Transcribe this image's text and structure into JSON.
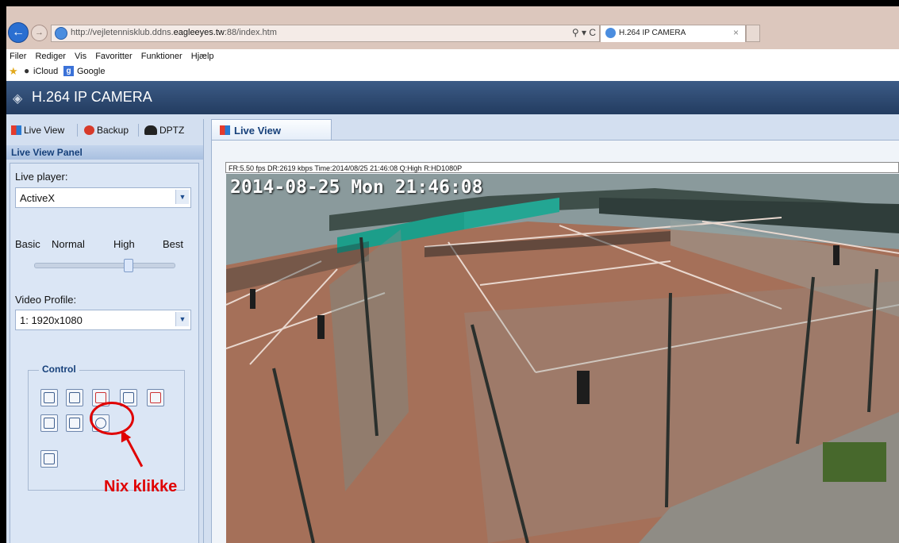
{
  "browser": {
    "url_prefix": "http://vejletennisklub.ddns.",
    "url_domain": "eagleeyes.tw",
    "url_suffix": ":88/index.htm",
    "search_glyph": "⚲ ▾ C",
    "tab_title": "H.264 IP CAMERA",
    "tab_close": "×",
    "menu": [
      "Filer",
      "Rediger",
      "Vis",
      "Favoritter",
      "Funktioner",
      "Hjælp"
    ],
    "favorites": [
      "iCloud",
      "Google"
    ]
  },
  "app": {
    "title": "H.264 IP CAMERA",
    "nav": [
      "Live View",
      "Backup",
      "DPTZ"
    ],
    "panel_title": "Live View Panel",
    "live_player_label": "Live player:",
    "live_player_value": "ActiveX",
    "quality_labels": [
      "Basic",
      "Normal",
      "High",
      "Best"
    ],
    "quality_value": "High",
    "video_profile_label": "Video Profile:",
    "video_profile_value": "1: 1920x1080",
    "control_label": "Control",
    "live_tab": "Live View",
    "status_line": "FR:5.50 fps  DR:2619 kbps Time:2014/08/25 21:46:08 Q:High R:HD1080P",
    "osd_timestamp": "2014-08-25 Mon 21:46:08",
    "annotation": "Nix klikke"
  },
  "colors": {
    "header": "#2c4a73",
    "panel": "#d3dff0",
    "accent_red": "#e00000"
  }
}
